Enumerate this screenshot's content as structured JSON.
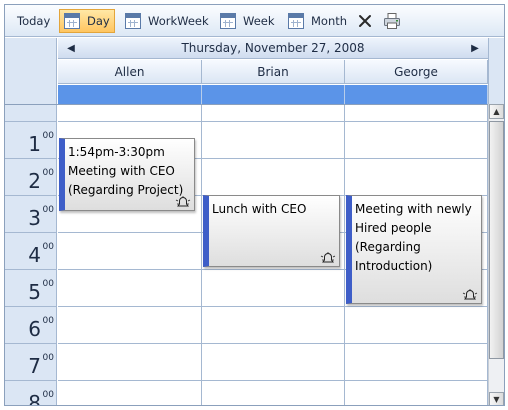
{
  "toolbar": {
    "today_label": "Today",
    "day_label": "Day",
    "workweek_label": "WorkWeek",
    "week_label": "Week",
    "month_label": "Month",
    "delete_icon": "close-x-icon",
    "print_icon": "printer-icon"
  },
  "navigator": {
    "date": "Thursday, November 27, 2008",
    "prev_icon": "chevron-left-icon",
    "next_icon": "chevron-right-icon"
  },
  "resources": [
    "Allen",
    "Brian",
    "George"
  ],
  "hours": [
    {
      "h": "1",
      "m": "00"
    },
    {
      "h": "2",
      "m": "00"
    },
    {
      "h": "3",
      "m": "00"
    },
    {
      "h": "4",
      "m": "00"
    },
    {
      "h": "5",
      "m": "00"
    },
    {
      "h": "6",
      "m": "00"
    },
    {
      "h": "7",
      "m": "00"
    },
    {
      "h": "8",
      "m": "00"
    }
  ],
  "appointments": [
    {
      "resource": "Allen",
      "line1": "1:54pm-3:30pm",
      "line2": "Meeting with CEO",
      "line3": "(Regarding Project)",
      "line4": ""
    },
    {
      "resource": "Brian",
      "line1": "Lunch with CEO",
      "line2": "",
      "line3": "",
      "line4": ""
    },
    {
      "resource": "George",
      "line1": "Meeting with newly",
      "line2": "Hired people",
      "line3": "(Regarding",
      "line4": "Introduction)"
    }
  ],
  "colors": {
    "accent_blue": "#3e5ec8",
    "allday_bar": "#5b94e8",
    "active_view": "#ffc560"
  },
  "active_view": "Day"
}
